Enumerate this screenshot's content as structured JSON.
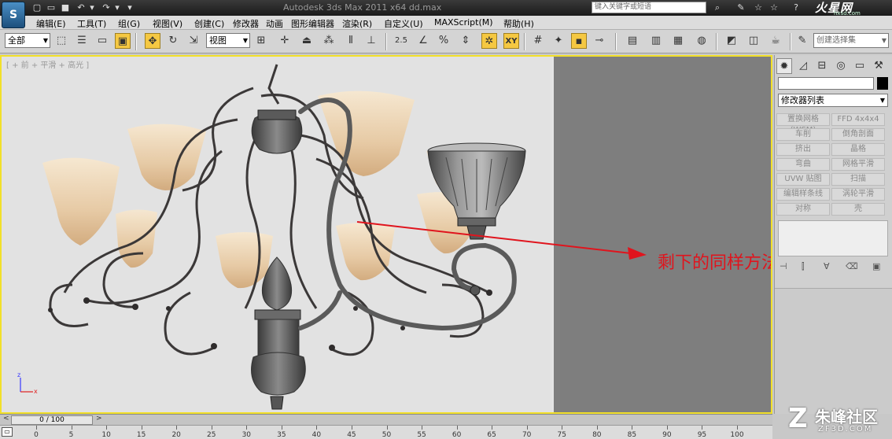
{
  "titlebar": {
    "app_logo": "S",
    "title": "Autodesk 3ds Max  2011 x64       dd.max",
    "search_placeholder": "键入关键字或短语",
    "brand": "火星网",
    "brand_url": "hxsd.com"
  },
  "menu": [
    "编辑(E)",
    "工具(T)",
    "组(G)",
    "视图(V)",
    "创建(C)",
    "修改器",
    "动画",
    "图形编辑器",
    "渲染(R)",
    "自定义(U)",
    "MAXScript(M)",
    "帮助(H)"
  ],
  "toolbar": {
    "selection_filter": "全部",
    "ref_coord": "视图",
    "snap_label": "2.5",
    "xy_label": "XY",
    "named_selection": "创建选择集"
  },
  "viewport": {
    "label": "[ + 前 + 平滑 + 高光 ]",
    "annotation": "剩下的同样方法做出来",
    "annotation_color": "#e0141d",
    "axis_x": "x",
    "axis_z": "z"
  },
  "command_panel": {
    "modifier_list": "修改器列表",
    "modifiers": [
      [
        "置换网格 (WSM)",
        "FFD 4x4x4"
      ],
      [
        "车削",
        "倒角剖面"
      ],
      [
        "挤出",
        "晶格"
      ],
      [
        "弯曲",
        "网格平滑"
      ],
      [
        "UVW 贴图",
        "扫描"
      ],
      [
        "编辑样条线",
        "涡轮平滑"
      ],
      [
        "对称",
        "壳"
      ]
    ]
  },
  "timeline": {
    "frame": "0 / 100",
    "ticks": [
      "0",
      "5",
      "10",
      "15",
      "20",
      "25",
      "30",
      "35",
      "40",
      "45",
      "50",
      "55",
      "60",
      "65",
      "70",
      "75",
      "80",
      "85",
      "90",
      "95",
      "100"
    ]
  },
  "watermark": {
    "mark": "Z",
    "text": "朱峰社区",
    "url": "ZF3D.COM"
  }
}
